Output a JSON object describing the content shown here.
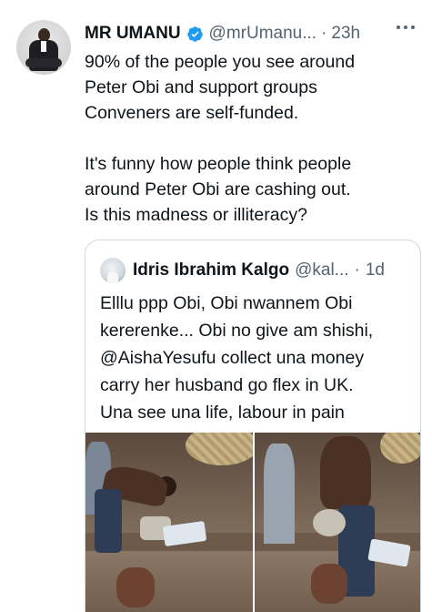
{
  "tweet": {
    "author_name": "MR UMANU",
    "handle": "@mrUmanu...",
    "separator": "·",
    "time": "23h",
    "lines": [
      "90% of the people you see around",
      "Peter Obi and support groups",
      "Conveners are self-funded.",
      "",
      "It's funny how people think people",
      "around Peter Obi are cashing out.",
      "Is this madness or illiteracy?"
    ],
    "icons": {
      "verified": "verified-badge-icon",
      "more": "more-options-icon"
    },
    "colors": {
      "verified": "#1d9bf0",
      "text": "#0f1419",
      "muted": "#536471",
      "border": "#cfd9de"
    }
  },
  "quote": {
    "author_name": "Idris Ibrahim Kalgo",
    "handle": "@kal...",
    "separator": "·",
    "time": "1d",
    "lines": [
      "Elllu ppp Obi, Obi nwannem Obi",
      "kererenke... Obi no give am shishi,",
      "@AishaYesufu collect una money",
      "carry her husband go flex in UK.",
      "Una see una life, labour in pain"
    ]
  }
}
